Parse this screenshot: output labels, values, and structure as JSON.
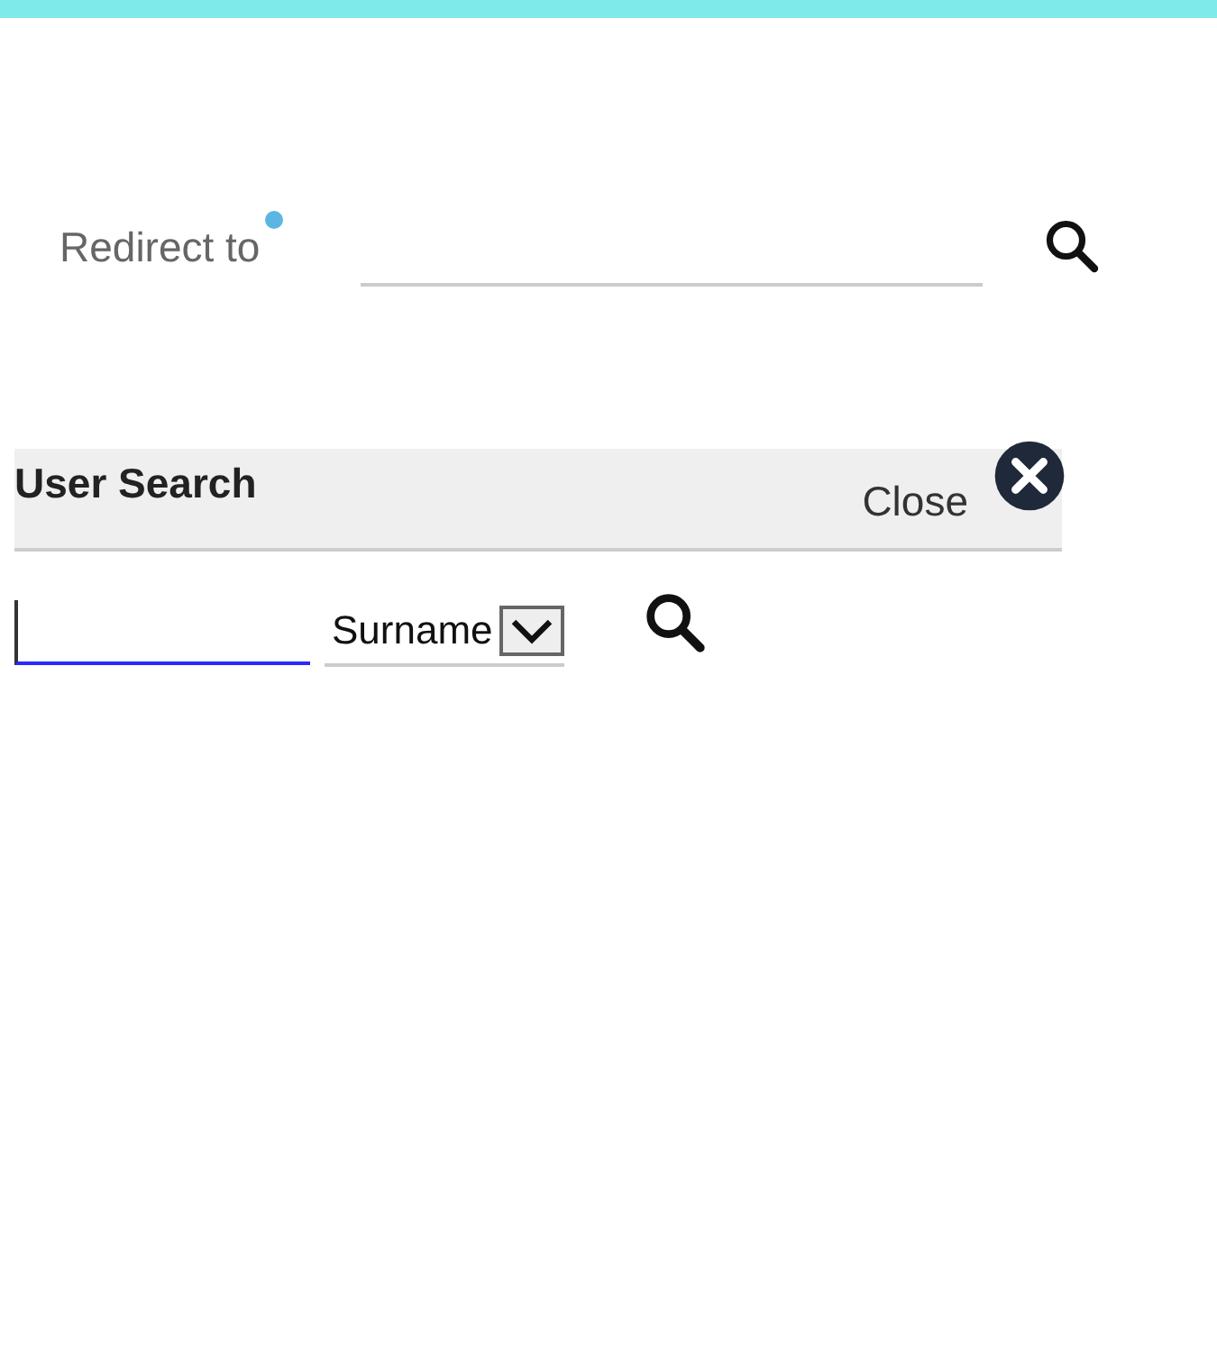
{
  "redirect": {
    "label": "Redirect to",
    "required": true
  },
  "user_search": {
    "title": "User Search",
    "close": "Close",
    "search_by": "Surname"
  }
}
